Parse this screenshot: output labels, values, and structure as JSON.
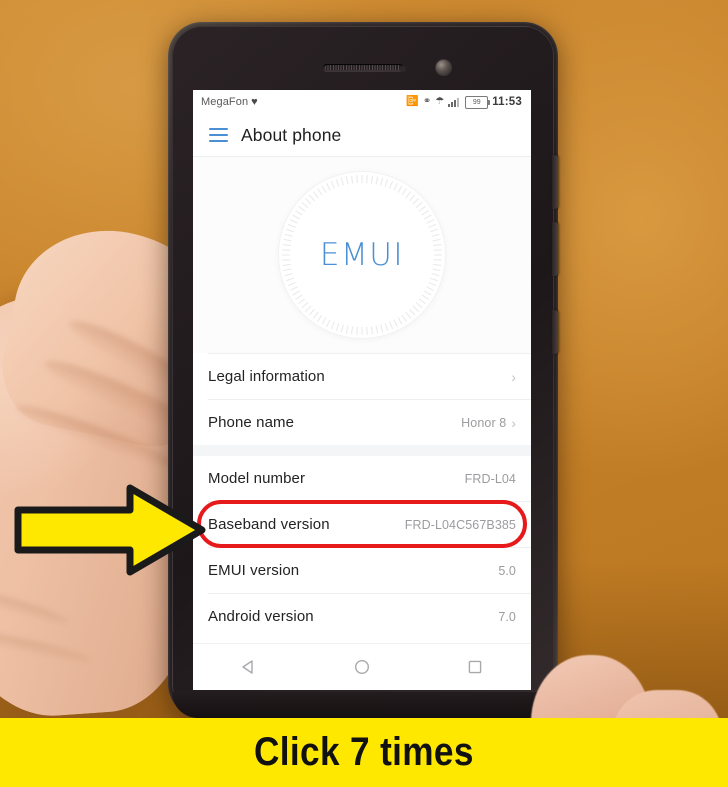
{
  "scene": {
    "description": "photo-of-hand-holding-phone",
    "background_color": "#c8832b"
  },
  "phone": {
    "status_bar": {
      "carrier": "MegaFon",
      "carrier_badge_icon": "heart-icon",
      "icons": [
        "vibrate-icon",
        "bluetooth-icon",
        "wifi-icon",
        "signal-bars-icon"
      ],
      "battery_level": "99",
      "clock": "11:53"
    },
    "app_bar": {
      "menu_icon": "hamburger-menu-icon",
      "title": "About phone"
    },
    "logo": {
      "wordmark": "EMUI",
      "color": "#4a8fd4"
    },
    "settings_rows": [
      {
        "label": "Legal information",
        "value": "",
        "chevron": true
      },
      {
        "label": "Phone name",
        "value": "Honor 8",
        "chevron": true
      },
      {
        "label": "Model number",
        "value": "FRD-L04",
        "chevron": false
      },
      {
        "label": "Baseband version",
        "value": "FRD-L04C567B385",
        "chevron": false,
        "highlighted": true
      },
      {
        "label": "EMUI version",
        "value": "5.0",
        "chevron": false
      },
      {
        "label": "Android version",
        "value": "7.0",
        "chevron": false
      }
    ],
    "nav_bar": {
      "back_icon": "back-triangle-icon",
      "home_icon": "home-circle-icon",
      "recents_icon": "recents-square-icon"
    }
  },
  "annotations": {
    "highlight_color": "#e61a1a",
    "arrow": {
      "icon": "right-arrow-icon",
      "fill": "#ffe800",
      "stroke": "#1a1a1a"
    }
  },
  "caption": {
    "text": "Click 7 times",
    "background": "#ffe800",
    "color": "#111112"
  }
}
